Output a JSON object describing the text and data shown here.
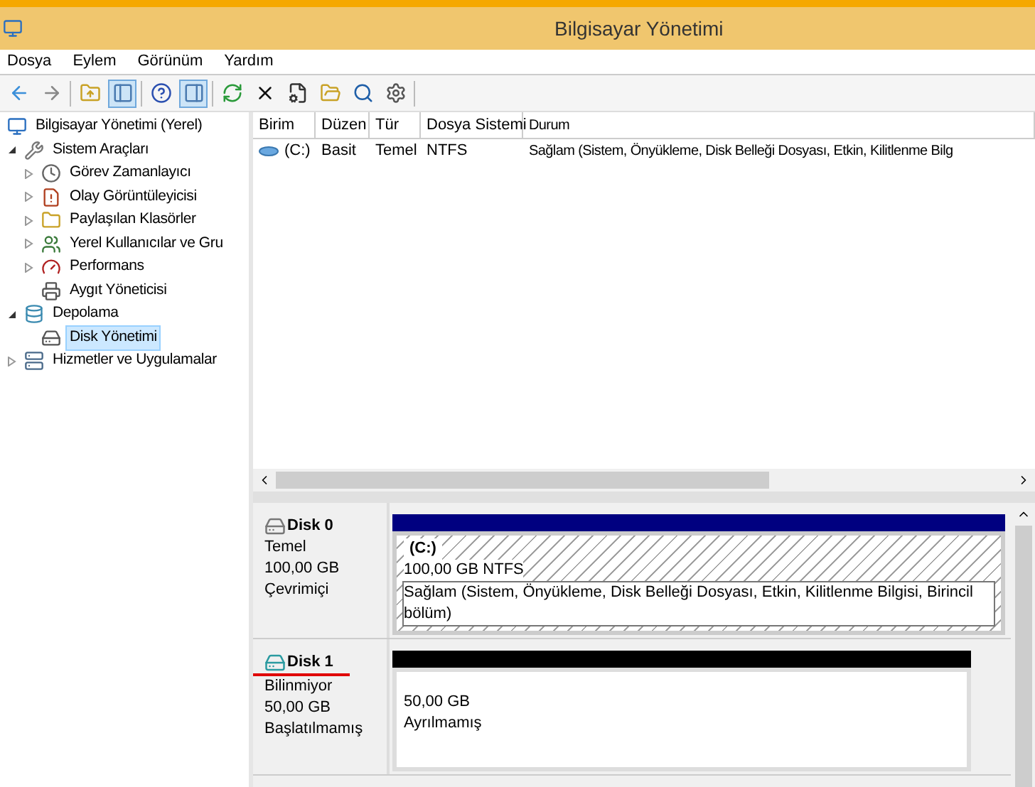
{
  "window": {
    "title": "Bilgisayar Yönetimi"
  },
  "menu": [
    "Dosya",
    "Eylem",
    "Görünüm",
    "Yardım"
  ],
  "toolbar": [
    [
      {
        "kind": "back",
        "pressed": false
      },
      {
        "kind": "forward",
        "pressed": false
      }
    ],
    [
      {
        "kind": "up",
        "pressed": false
      },
      {
        "kind": "tree",
        "pressed": true
      }
    ],
    [
      {
        "kind": "help",
        "pressed": false
      },
      {
        "kind": "actions",
        "pressed": true
      }
    ],
    [
      {
        "kind": "refresh",
        "pressed": false
      },
      {
        "kind": "delete",
        "pressed": false
      },
      {
        "kind": "properties",
        "pressed": false
      },
      {
        "kind": "open",
        "pressed": false
      },
      {
        "kind": "find",
        "pressed": false
      },
      {
        "kind": "settings",
        "pressed": false
      }
    ]
  ],
  "tree": [
    {
      "label": "Bilgisayar Yönetimi (Yerel)",
      "kind": "computer",
      "selected": false,
      "children": [
        {
          "label": "Sistem Araçları",
          "kind": "tools",
          "selected": false,
          "expanded": true,
          "children": [
            {
              "label": "Görev Zamanlayıcı",
              "kind": "clock",
              "selected": false,
              "expanded": false
            },
            {
              "label": "Olay Görüntüleyicisi",
              "kind": "log",
              "selected": false,
              "expanded": false
            },
            {
              "label": "Paylaşılan Klasörler",
              "kind": "folder",
              "selected": false,
              "expanded": false
            },
            {
              "label": "Yerel Kullanıcılar ve Gru",
              "kind": "users",
              "selected": false,
              "expanded": false
            },
            {
              "label": "Performans",
              "kind": "gauge",
              "selected": false,
              "expanded": false
            },
            {
              "label": "Aygıt Yöneticisi",
              "kind": "device",
              "selected": false
            }
          ]
        },
        {
          "label": "Depolama",
          "kind": "storage",
          "selected": false,
          "expanded": true,
          "children": [
            {
              "label": "Disk Yönetimi",
              "kind": "disk",
              "selected": true
            }
          ]
        },
        {
          "label": "Hizmetler ve Uygulamalar",
          "kind": "services",
          "selected": false,
          "expanded": false
        }
      ]
    }
  ],
  "volumes": {
    "columns": [
      "Birim",
      "Düzen",
      "Tür",
      "Dosya Sistemi",
      "Durum"
    ],
    "rows": [
      [
        "(C:)",
        "Basit",
        "Temel",
        "NTFS",
        "Sağlam (Sistem, Önyükleme, Disk Belleği Dosyası, Etkin, Kilitlenme Bilg"
      ]
    ]
  },
  "disks": [
    {
      "name": "Disk 0",
      "kind": "basic",
      "type": "Temel",
      "size": "100,00 GB",
      "status": "Çevrimiçi",
      "color": "#000080",
      "partition": {
        "kind": "primary",
        "label": "(C:)",
        "size": "100,00 GB NTFS",
        "status": "Sağlam (Sistem, Önyükleme, Disk Belleği Dosyası, Etkin, Kilitlenme Bilgisi, Birincil bölüm)"
      }
    },
    {
      "name": "Disk 1",
      "kind": "unknown",
      "type": "Bilinmiyor",
      "size": "50,00 GB",
      "status": "Başlatılmamış",
      "color": "#000000",
      "partition": {
        "kind": "unallocated",
        "size": "50,00 GB",
        "status": "Ayrılmamış"
      }
    }
  ]
}
